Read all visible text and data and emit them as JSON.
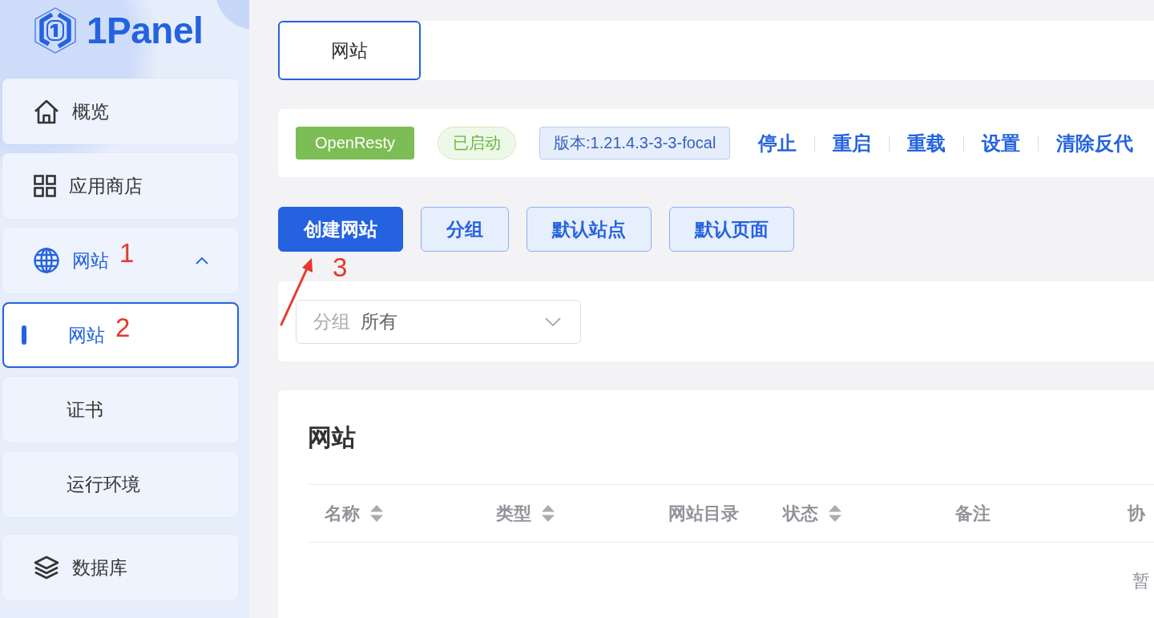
{
  "logo": {
    "text": "1Panel"
  },
  "sidebar": {
    "items": [
      {
        "label": "概览",
        "selected": false
      },
      {
        "label": "应用商店",
        "selected": false
      },
      {
        "label": "网站",
        "selected": false,
        "expanded": true,
        "annotation": "1",
        "children": [
          {
            "label": "网站",
            "selected": true,
            "annotation": "2"
          },
          {
            "label": "证书",
            "selected": false
          },
          {
            "label": "运行环境",
            "selected": false
          }
        ]
      },
      {
        "label": "数据库",
        "selected": false
      }
    ]
  },
  "tabs": [
    {
      "label": "网站",
      "selected": true
    }
  ],
  "server_status": {
    "app": "OpenResty",
    "status": "已启动",
    "version": "版本:1.21.4.3-3-3-focal",
    "actions": [
      "停止",
      "重启",
      "重载",
      "设置",
      "清除反代"
    ]
  },
  "toolbar": {
    "buttons": [
      {
        "label": "创建网站",
        "kind": "primary",
        "annotation": "3"
      },
      {
        "label": "分组",
        "kind": "secondary"
      },
      {
        "label": "默认站点",
        "kind": "secondary"
      },
      {
        "label": "默认页面",
        "kind": "secondary"
      }
    ]
  },
  "filter": {
    "label": "分组",
    "value": "所有"
  },
  "table": {
    "title": "网站",
    "columns": [
      {
        "label": "名称",
        "sortable": true
      },
      {
        "label": "类型",
        "sortable": true
      },
      {
        "label": "网站目录",
        "sortable": false
      },
      {
        "label": "状态",
        "sortable": true
      },
      {
        "label": "备注",
        "sortable": false
      },
      {
        "label": "协"
      }
    ],
    "empty_text": "暂"
  }
}
